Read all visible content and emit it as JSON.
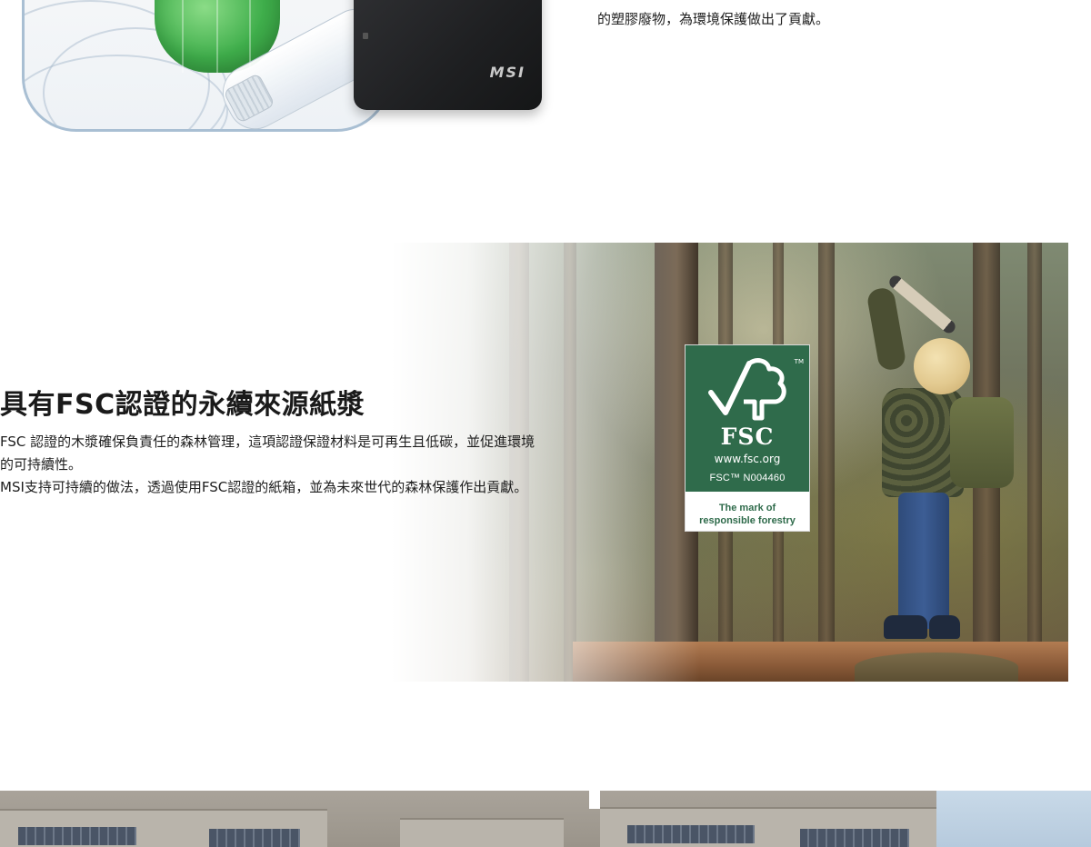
{
  "top_section": {
    "description_line": "的塑膠廢物，為環境保護做出了貢獻。",
    "pc_logo": "MSI"
  },
  "fsc_section": {
    "heading": "具有FSC認證的永續來源紙漿",
    "paragraph_1": "FSC 認證的木漿確保負責任的森林管理，這項認證保證材料是可再生且低碳，並促進環境的可持續性。",
    "paragraph_2": "MSI支持可持續的做法，透過使用FSC認證的紙箱，並為未來世代的森林保護作出貢獻。",
    "badge": {
      "tm": "TM",
      "name": "FSC",
      "url": "www.fsc.org",
      "license_code": "FSC™ N004460",
      "mark_line1": "The mark of",
      "mark_line2": "responsible forestry",
      "color": "#2f6b4b"
    }
  },
  "colors": {
    "text": "#1e1e1e",
    "heading": "#1a1a1a",
    "fsc_green": "#2f6b4b",
    "frame_border": "#a9bfd3"
  },
  "icons": {
    "fsc_tree": "fsc-checkmark-tree-icon"
  }
}
